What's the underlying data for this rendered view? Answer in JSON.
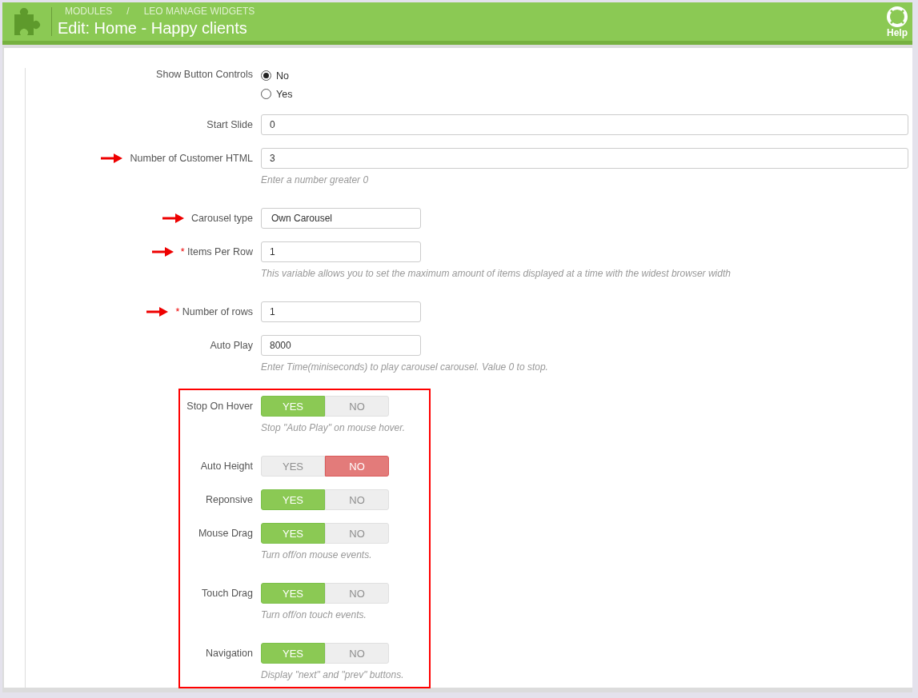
{
  "header": {
    "breadcrumbs": [
      "MODULES",
      "LEO MANAGE WIDGETS"
    ],
    "separator": "/",
    "title": "Edit: Home - Happy clients",
    "help": "Help"
  },
  "sections": [
    {
      "highlighted": false,
      "fields": [
        {
          "kind": "radio",
          "label": "Show Button Controls",
          "arrow": false,
          "options": [
            {
              "label": "No",
              "selected": true
            },
            {
              "label": "Yes",
              "selected": false
            }
          ]
        },
        {
          "kind": "wide_text",
          "label": "Start Slide",
          "arrow": false,
          "value": "0"
        },
        {
          "kind": "wide_text",
          "label": "Number of Customer HTML",
          "arrow": true,
          "value": "3",
          "hint": "Enter a number greater 0"
        },
        {
          "kind": "select",
          "label": "Carousel type",
          "arrow": true,
          "value": "Own Carousel"
        },
        {
          "kind": "text",
          "label": "Items Per Row",
          "marker": "*",
          "arrow": true,
          "value": "1",
          "hint": "This variable allows you to set the maximum amount of items displayed at a time with the widest browser width"
        },
        {
          "kind": "text",
          "label": "Number of rows",
          "marker": "*",
          "arrow": true,
          "value": "1"
        },
        {
          "kind": "text",
          "label": "Auto Play",
          "arrow": false,
          "value": "8000",
          "hint": "Enter Time(miniseconds) to play carousel carousel. Value 0 to stop."
        }
      ]
    },
    {
      "highlighted": true,
      "fields": [
        {
          "kind": "toggle",
          "label": "Stop On Hover",
          "arrow": false,
          "options": [
            {
              "label": "YES",
              "selected": true
            },
            {
              "label": "NO",
              "selected": false
            }
          ],
          "hint": "Stop \"Auto Play\" on mouse hover."
        },
        {
          "kind": "toggle",
          "label": "Auto Height",
          "arrow": false,
          "options": [
            {
              "label": "YES",
              "selected": false
            },
            {
              "label": "NO",
              "selected": true
            }
          ]
        },
        {
          "kind": "toggle",
          "label": "Reponsive",
          "arrow": false,
          "options": [
            {
              "label": "YES",
              "selected": true
            },
            {
              "label": "NO",
              "selected": false
            }
          ]
        },
        {
          "kind": "toggle",
          "label": "Mouse Drag",
          "arrow": false,
          "options": [
            {
              "label": "YES",
              "selected": true
            },
            {
              "label": "NO",
              "selected": false
            }
          ],
          "hint": "Turn off/on mouse events."
        },
        {
          "kind": "toggle",
          "label": "Touch Drag",
          "arrow": false,
          "options": [
            {
              "label": "YES",
              "selected": true
            },
            {
              "label": "NO",
              "selected": false
            }
          ],
          "hint": "Turn off/on touch events."
        },
        {
          "kind": "toggle",
          "label": "Navigation",
          "arrow": false,
          "options": [
            {
              "label": "YES",
              "selected": true
            },
            {
              "label": "NO",
              "selected": false
            }
          ],
          "hint": "Display \"next\" and \"prev\" buttons."
        }
      ]
    }
  ]
}
